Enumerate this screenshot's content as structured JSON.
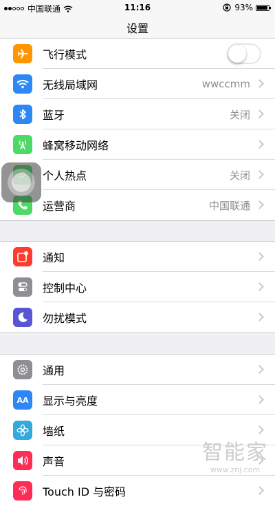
{
  "status_bar": {
    "carrier": "中国联通",
    "time": "11:16",
    "battery": "93%",
    "battery_level": 0.93
  },
  "nav": {
    "title": "设置"
  },
  "groups": [
    {
      "rows": [
        {
          "label": "飞行模式",
          "icon": "airplane-icon",
          "color": "#ff9500",
          "toggle": false
        },
        {
          "label": "无线局域网",
          "value": "wwccmm",
          "icon": "wifi-icon",
          "color": "#2d88f6"
        },
        {
          "label": "蓝牙",
          "value": "关闭",
          "icon": "bluetooth-icon",
          "color": "#2d88f6"
        },
        {
          "label": "蜂窝移动网络",
          "icon": "cellular-icon",
          "color": "#4cd964"
        },
        {
          "label": "个人热点",
          "value": "关闭",
          "icon": "hotspot-icon",
          "color": "#4cd964"
        },
        {
          "label": "运营商",
          "value": "中国联通",
          "icon": "phone-icon",
          "color": "#4cd964"
        }
      ]
    },
    {
      "rows": [
        {
          "label": "通知",
          "icon": "notification-icon",
          "color": "#ff3b30"
        },
        {
          "label": "控制中心",
          "icon": "control-center-icon",
          "color": "#8e8e93"
        },
        {
          "label": "勿扰模式",
          "icon": "moon-icon",
          "color": "#5856d6"
        }
      ]
    },
    {
      "rows": [
        {
          "label": "通用",
          "icon": "gear-icon",
          "color": "#8e8e93"
        },
        {
          "label": "显示与亮度",
          "icon": "display-brightness-icon",
          "color": "#2d88f6",
          "glyph": "AA"
        },
        {
          "label": "墙纸",
          "icon": "wallpaper-icon",
          "color": "#33aadc"
        },
        {
          "label": "声音",
          "icon": "sound-icon",
          "color": "#ff2d55"
        },
        {
          "label": "Touch ID 与密码",
          "icon": "fingerprint-icon",
          "color": "#ff2d55"
        }
      ]
    }
  ],
  "watermark": {
    "title": "智能家",
    "url": "www.znj.com"
  }
}
